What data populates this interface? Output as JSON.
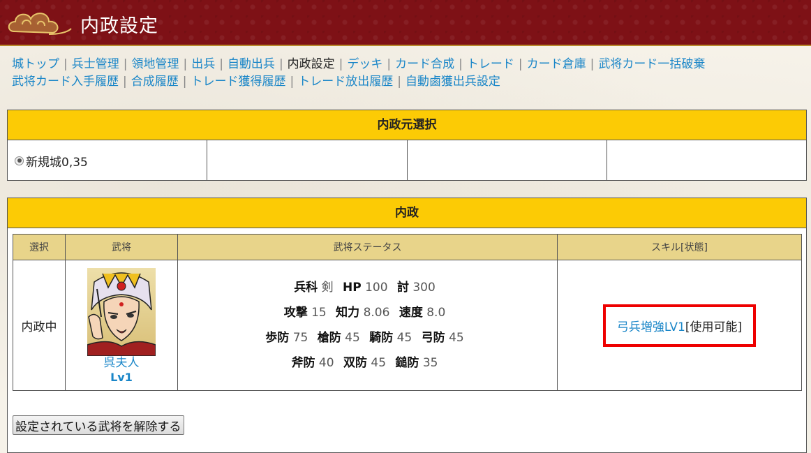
{
  "header": {
    "title": "内政設定"
  },
  "nav": {
    "line1": [
      "城トップ",
      "兵士管理",
      "領地管理",
      "出兵",
      "自動出兵",
      "内政設定",
      "デッキ",
      "カード合成",
      "トレード",
      "カード倉庫",
      "武将カード一括破棄"
    ],
    "line2": [
      "武将カード入手履歴",
      "合成履歴",
      "トレード獲得履歴",
      "トレード放出履歴",
      "自動鹵獲出兵設定"
    ],
    "current": "内政設定"
  },
  "source_panel": {
    "title": "内政元選択",
    "selected_castle": "新規城0,35"
  },
  "naisei_panel": {
    "title": "内政",
    "columns": [
      "選択",
      "武将",
      "武将ステータス",
      "スキル[状態]"
    ],
    "row": {
      "status": "内政中",
      "general_name": "呉夫人",
      "general_lv_label": "Lv",
      "general_lv": "1",
      "stats": {
        "unit_label": "兵科",
        "unit": "剣",
        "hp_label": "HP",
        "hp": "100",
        "tou_label": "討",
        "tou": "300",
        "atk_label": "攻撃",
        "atk": "15",
        "int_label": "知力",
        "int": "8.06",
        "spd_label": "速度",
        "spd": "8.0",
        "def_inf_label": "歩防",
        "def_inf": "75",
        "def_spear_label": "槍防",
        "def_spear": "45",
        "def_cav_label": "騎防",
        "def_cav": "45",
        "def_bow_label": "弓防",
        "def_bow": "45",
        "def_axe_label": "斧防",
        "def_axe": "40",
        "def_halberd_label": "双防",
        "def_halberd": "45",
        "def_hammer_label": "鎚防",
        "def_hammer": "35"
      },
      "skill_name": "弓兵増強LV1",
      "skill_state": "[使用可能]"
    },
    "release_button": "設定されている武将を解除する"
  },
  "colors": {
    "banner": "#7e1116",
    "panel_header": "#fccb05",
    "column_header": "#e8d48a",
    "link": "#1a86c8",
    "highlight": "#e00000"
  }
}
